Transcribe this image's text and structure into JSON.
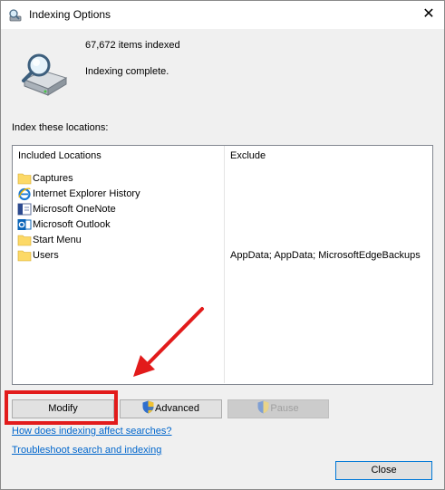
{
  "window": {
    "title": "Indexing Options",
    "close_glyph": "✕"
  },
  "status": {
    "items_count": "67,672 items indexed",
    "state": "Indexing complete."
  },
  "locations": {
    "section_label": "Index these locations:",
    "headers": {
      "included": "Included Locations",
      "exclude": "Exclude"
    },
    "rows": [
      {
        "icon": "folder-icon",
        "label": "Captures",
        "exclude": ""
      },
      {
        "icon": "internet-explorer-icon",
        "label": "Internet Explorer History",
        "exclude": ""
      },
      {
        "icon": "onenote-icon",
        "label": "Microsoft OneNote",
        "exclude": ""
      },
      {
        "icon": "outlook-icon",
        "label": "Microsoft Outlook",
        "exclude": ""
      },
      {
        "icon": "folder-icon",
        "label": "Start Menu",
        "exclude": ""
      },
      {
        "icon": "folder-icon",
        "label": "Users",
        "exclude": "AppData; AppData; MicrosoftEdgeBackups"
      }
    ]
  },
  "buttons": {
    "modify": "Modify",
    "advanced": "Advanced",
    "pause": "Pause",
    "close": "Close"
  },
  "links": {
    "how_affect": "How does indexing affect searches?",
    "troubleshoot": "Troubleshoot search and indexing"
  },
  "colors": {
    "annotation_red": "#e21b1b",
    "link_blue": "#0066cc",
    "folder_yellow": "#fcd967"
  }
}
